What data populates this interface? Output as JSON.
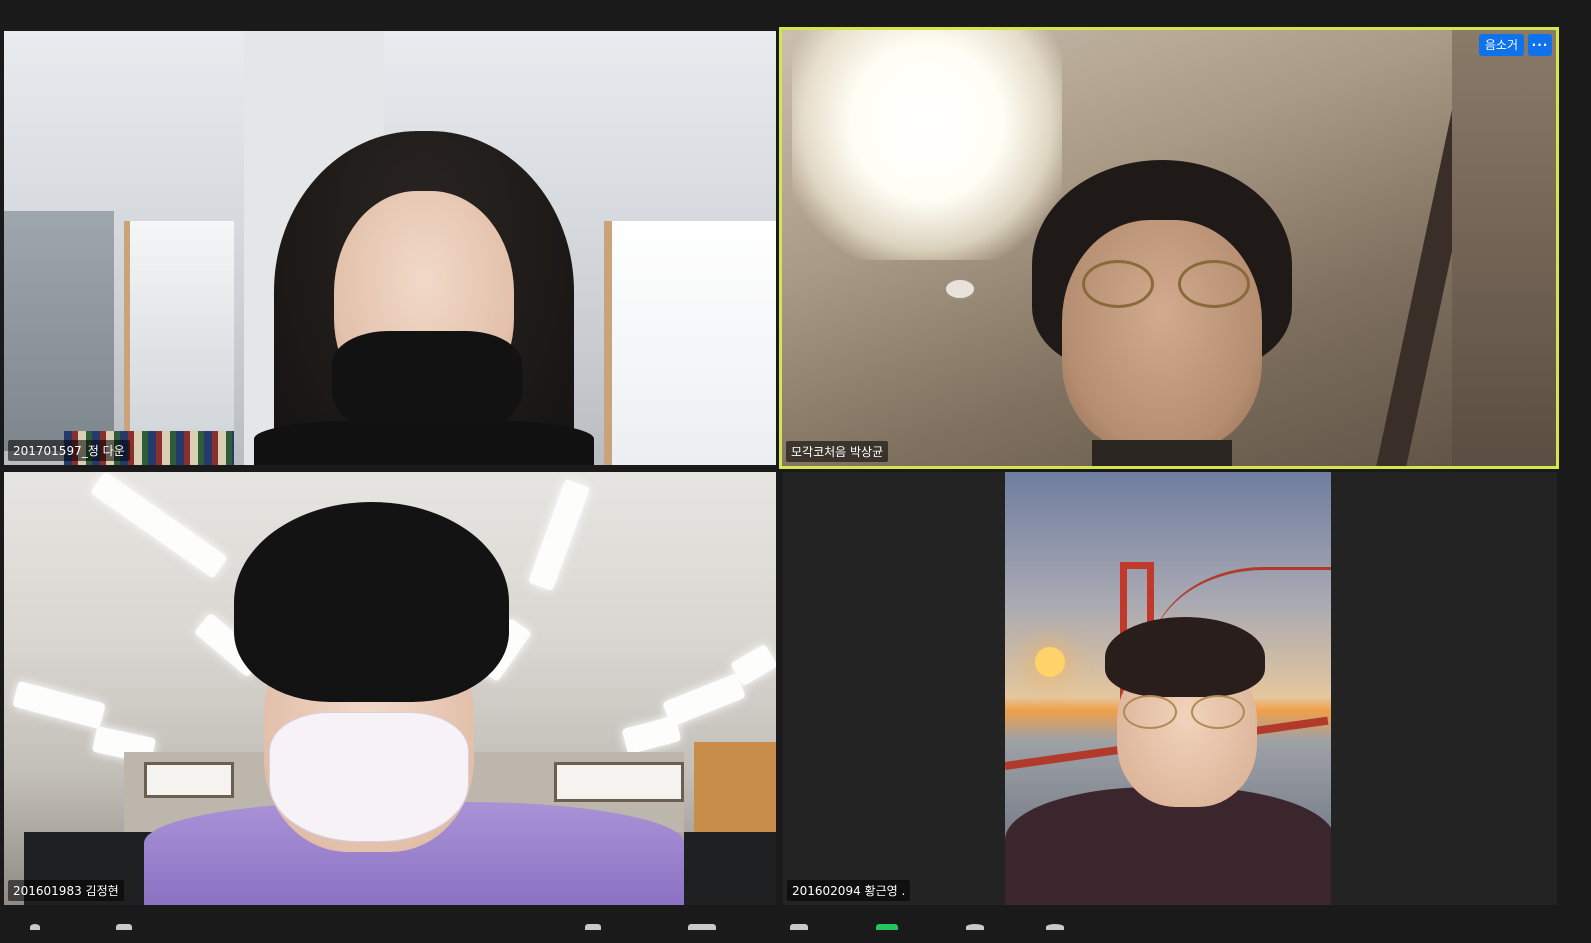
{
  "participants": [
    {
      "name": "201701597_정 다운",
      "active": false
    },
    {
      "name": "모각코처음 박상균",
      "active": true,
      "top_buttons": {
        "unmute_label": "음소거",
        "more_label": "···"
      }
    },
    {
      "name": "201601983 김정현",
      "active": false
    },
    {
      "name": "201602094 황근영 .",
      "active": false,
      "background": "virtual-bridge"
    }
  ],
  "colors": {
    "active_speaker_border": "#d4e64a",
    "button_blue": "#0e72ed",
    "background": "#1a1a1a",
    "toolbar_accent": "#22c55e"
  },
  "toolbar": {
    "icons": [
      "mic-icon",
      "video-icon",
      "security-icon",
      "participants-icon",
      "chat-icon",
      "share-screen-icon",
      "record-icon",
      "reactions-icon"
    ]
  }
}
